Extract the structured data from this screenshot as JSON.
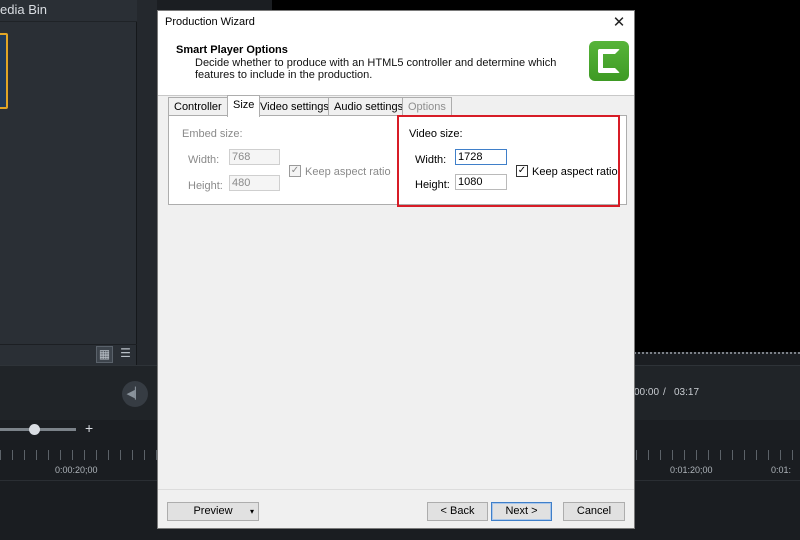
{
  "background_app": {
    "media_bin_title": "edia Bin",
    "view_grid_icon": "grid-icon",
    "view_list_icon": "list-icon",
    "play_back_icon": "step-back-icon",
    "zoom_plus": "+",
    "time_current": "00:00",
    "time_separator": "/",
    "time_total": "03:17",
    "timeline_ticks": [
      "0:00:20;00",
      "0:01:20;00",
      "0:01:"
    ]
  },
  "dialog": {
    "title": "Production Wizard",
    "close_label": "✕",
    "header_title": "Smart Player Options",
    "header_description": "Decide whether to produce with an HTML5 controller and determine which features to include in the production.",
    "tabs": [
      {
        "label": "Controller",
        "state": "normal"
      },
      {
        "label": "Size",
        "state": "active"
      },
      {
        "label": "Video settings",
        "state": "normal"
      },
      {
        "label": "Audio settings",
        "state": "normal"
      },
      {
        "label": "Options",
        "state": "disabled"
      }
    ],
    "embed": {
      "group_label": "Embed size:",
      "width_label": "Width:",
      "width_value": "768",
      "height_label": "Height:",
      "height_value": "480",
      "keep_aspect_label": "Keep aspect ratio",
      "keep_aspect_checked": "✓"
    },
    "video": {
      "group_label": "Video size:",
      "width_label": "Width:",
      "width_value": "1728",
      "height_label": "Height:",
      "height_value": "1080",
      "keep_aspect_label": "Keep aspect ratio",
      "keep_aspect_checked": "✓"
    },
    "footer": {
      "preview_label": "Preview",
      "preview_caret": "▾",
      "back_label": "< Back",
      "next_label": "Next >",
      "cancel_label": "Cancel"
    },
    "accent_color": "#d71c26",
    "logo_color": "#4aa82e"
  }
}
